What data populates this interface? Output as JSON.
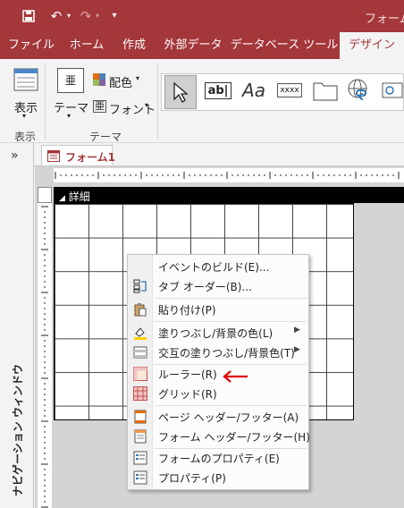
{
  "window": {
    "title": "フォーム ｺ"
  },
  "ribbon_tabs": [
    {
      "label": "ファイル"
    },
    {
      "label": "ホーム"
    },
    {
      "label": "作成"
    },
    {
      "label": "外部データ"
    },
    {
      "label": "データベース ツール"
    },
    {
      "label": "デザイン"
    }
  ],
  "ribbon": {
    "view_button": "表示",
    "view_group": "表示",
    "theme_button": "テーマ",
    "color_button": "配色",
    "font_button": "フォント",
    "theme_group": "テーマ",
    "textbox_label": "ab|",
    "label_label": "Aa",
    "button_label": "xxxx"
  },
  "nav_pane": {
    "title": "ナビゲーション ウィンドウ",
    "toggle": "»"
  },
  "document": {
    "tab_label": "フォーム1",
    "section_label": "詳細"
  },
  "context_menu": {
    "items": [
      {
        "label": "イベントのビルド(E)...",
        "icon": "none"
      },
      {
        "label": "タブ オーダー(B)...",
        "icon": "tab-order-icon"
      },
      {
        "label": "貼り付け(P)",
        "icon": "paste-icon"
      },
      {
        "label": "塗りつぶし/背景の色(L)",
        "icon": "fill-color-icon"
      },
      {
        "label": "交互の塗りつぶし/背景色(T)",
        "icon": "alternate-fill-icon"
      },
      {
        "label": "ルーラー(R)",
        "icon": "ruler-icon"
      },
      {
        "label": "グリッド(R)",
        "icon": "grid-icon"
      },
      {
        "label": "ページ ヘッダー/フッター(A)",
        "icon": "page-header-icon"
      },
      {
        "label": "フォーム ヘッダー/フッター(H)",
        "icon": "form-header-icon"
      },
      {
        "label": "フォームのプロパティ(E)",
        "icon": "form-properties-icon"
      },
      {
        "label": "プロパティ(P)",
        "icon": "properties-icon"
      }
    ]
  },
  "colors": {
    "accent": "#a4373a",
    "annotation_arrow": "#e00000"
  }
}
